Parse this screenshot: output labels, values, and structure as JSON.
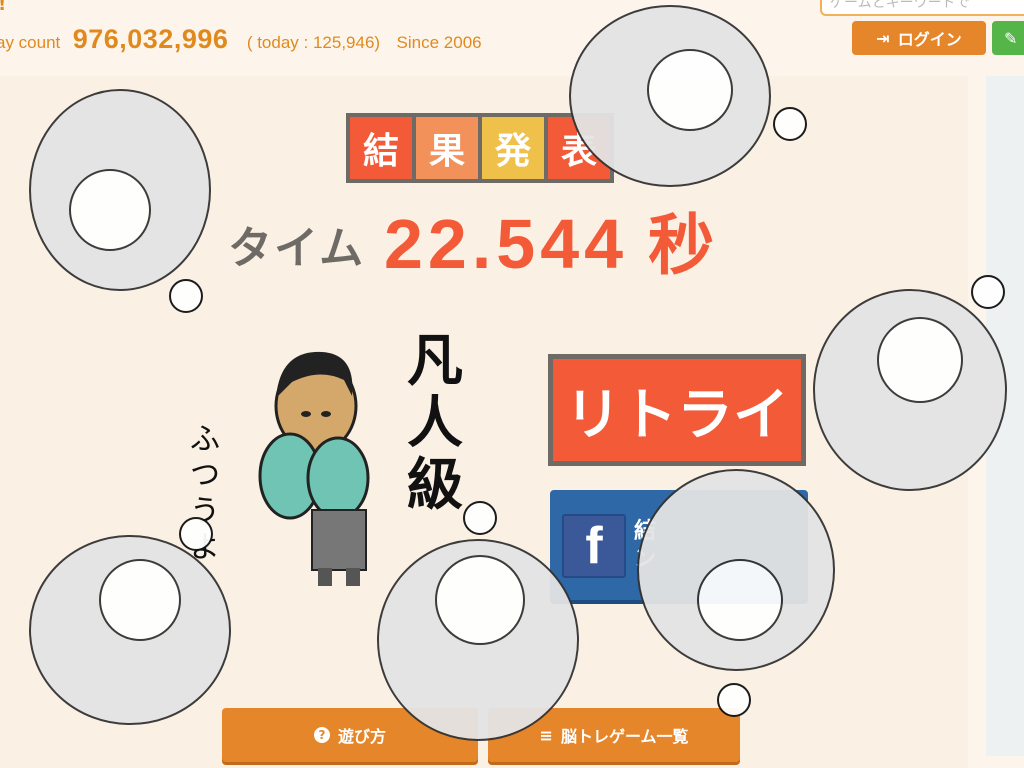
{
  "header": {
    "excl": "!",
    "count_label": "ay count",
    "count_value": "976,032,996",
    "today": "( today : 125,946)",
    "since": "Since 2006",
    "search_placeholder": "ゲームとキーワードで",
    "login_label": "ログイン"
  },
  "result": {
    "title_chars": [
      "結",
      "果",
      "発",
      "表"
    ],
    "time_label": "タイム",
    "time_value": "22.544",
    "time_unit": "秒",
    "rank_chars": [
      "凡",
      "人",
      "級"
    ],
    "quote_chars": [
      "ふ",
      "つ",
      "う",
      "よ"
    ],
    "retry_label": "リトライ",
    "share_line1": "結",
    "share_line2": "ン"
  },
  "footer": {
    "howto_label": "遊び方",
    "gamelist_label": "脳トレゲーム一覧"
  },
  "colors": {
    "accent": "#e6862a",
    "retry": "#f25a38",
    "facebook": "#2e68a6",
    "title_tiles": [
      "#f25a38",
      "#f2915a",
      "#efc14a",
      "#f25a38"
    ]
  }
}
